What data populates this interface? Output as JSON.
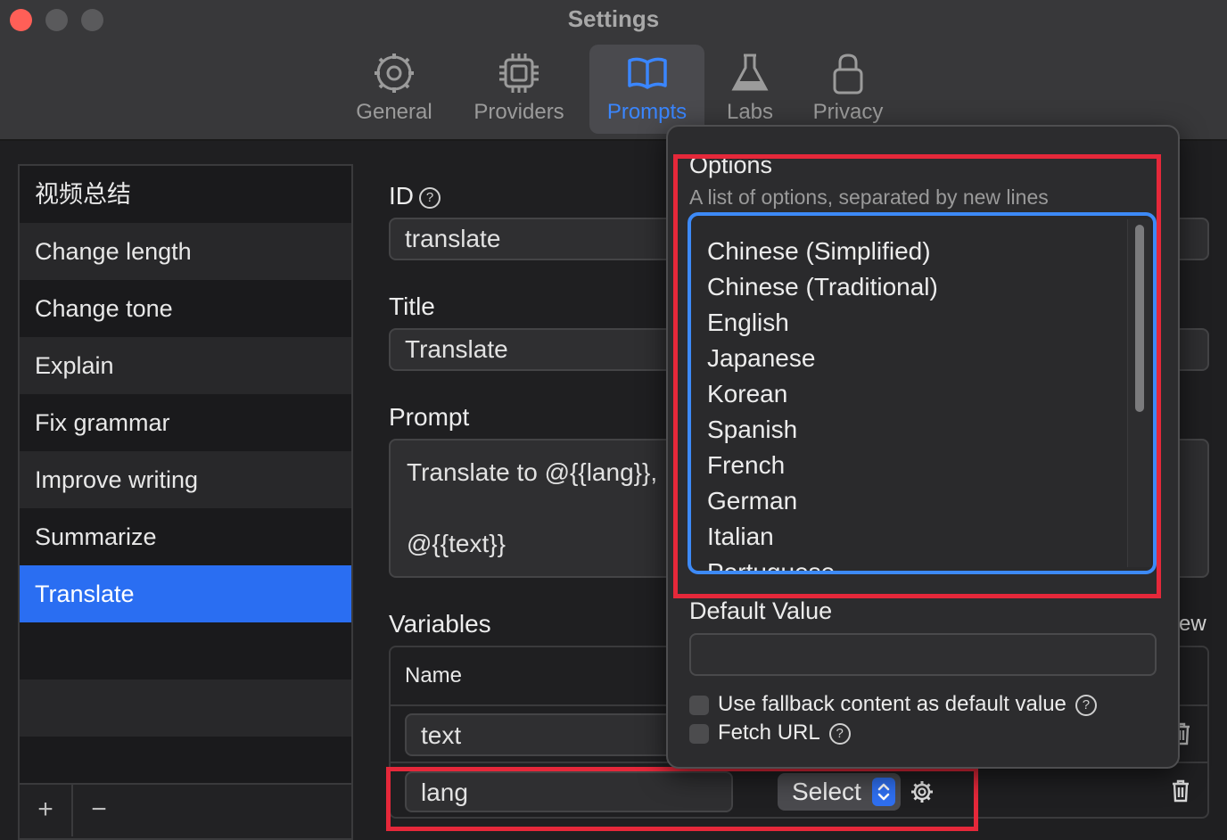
{
  "window": {
    "title": "Settings"
  },
  "toolbar": {
    "tabs": [
      {
        "label": "General",
        "icon": "gear-icon"
      },
      {
        "label": "Providers",
        "icon": "chip-icon"
      },
      {
        "label": "Prompts",
        "icon": "book-icon",
        "active": true
      },
      {
        "label": "Labs",
        "icon": "flask-icon"
      },
      {
        "label": "Privacy",
        "icon": "lock-icon"
      }
    ]
  },
  "sidebar": {
    "items": [
      {
        "label": "视频总结"
      },
      {
        "label": "Change length"
      },
      {
        "label": "Change tone"
      },
      {
        "label": "Explain"
      },
      {
        "label": "Fix grammar"
      },
      {
        "label": "Improve writing"
      },
      {
        "label": "Summarize"
      },
      {
        "label": "Translate",
        "selected": true
      }
    ],
    "add_label": "+",
    "remove_label": "−"
  },
  "form": {
    "id_label": "ID",
    "id_value": "translate",
    "title_label": "Title",
    "title_value": "Translate",
    "prompt_label": "Prompt",
    "prompt_line1": "Translate to @{{lang}},",
    "prompt_line2": "@{{text}}",
    "variables_label": "Variables",
    "variables_right_fragment": "ew",
    "variables": {
      "name_header": "Name",
      "rows": [
        {
          "name": "text"
        },
        {
          "name": "lang",
          "type": "Select"
        }
      ]
    }
  },
  "popover": {
    "options_title": "Options",
    "options_subtitle": "A list of options, separated by new lines",
    "options": [
      "Chinese (Simplified)",
      "Chinese (Traditional)",
      "English",
      "Japanese",
      "Korean",
      "Spanish",
      "French",
      "German",
      "Italian",
      "Portuguese"
    ],
    "default_value_label": "Default Value",
    "default_value": "",
    "fallback_checkbox_label": "Use fallback content as default value",
    "fetch_url_label": "Fetch URL",
    "help_glyph": "?"
  },
  "colors": {
    "accent": "#2a6ef2",
    "annotation": "#e5283a",
    "focus_ring": "#3d8af7"
  }
}
